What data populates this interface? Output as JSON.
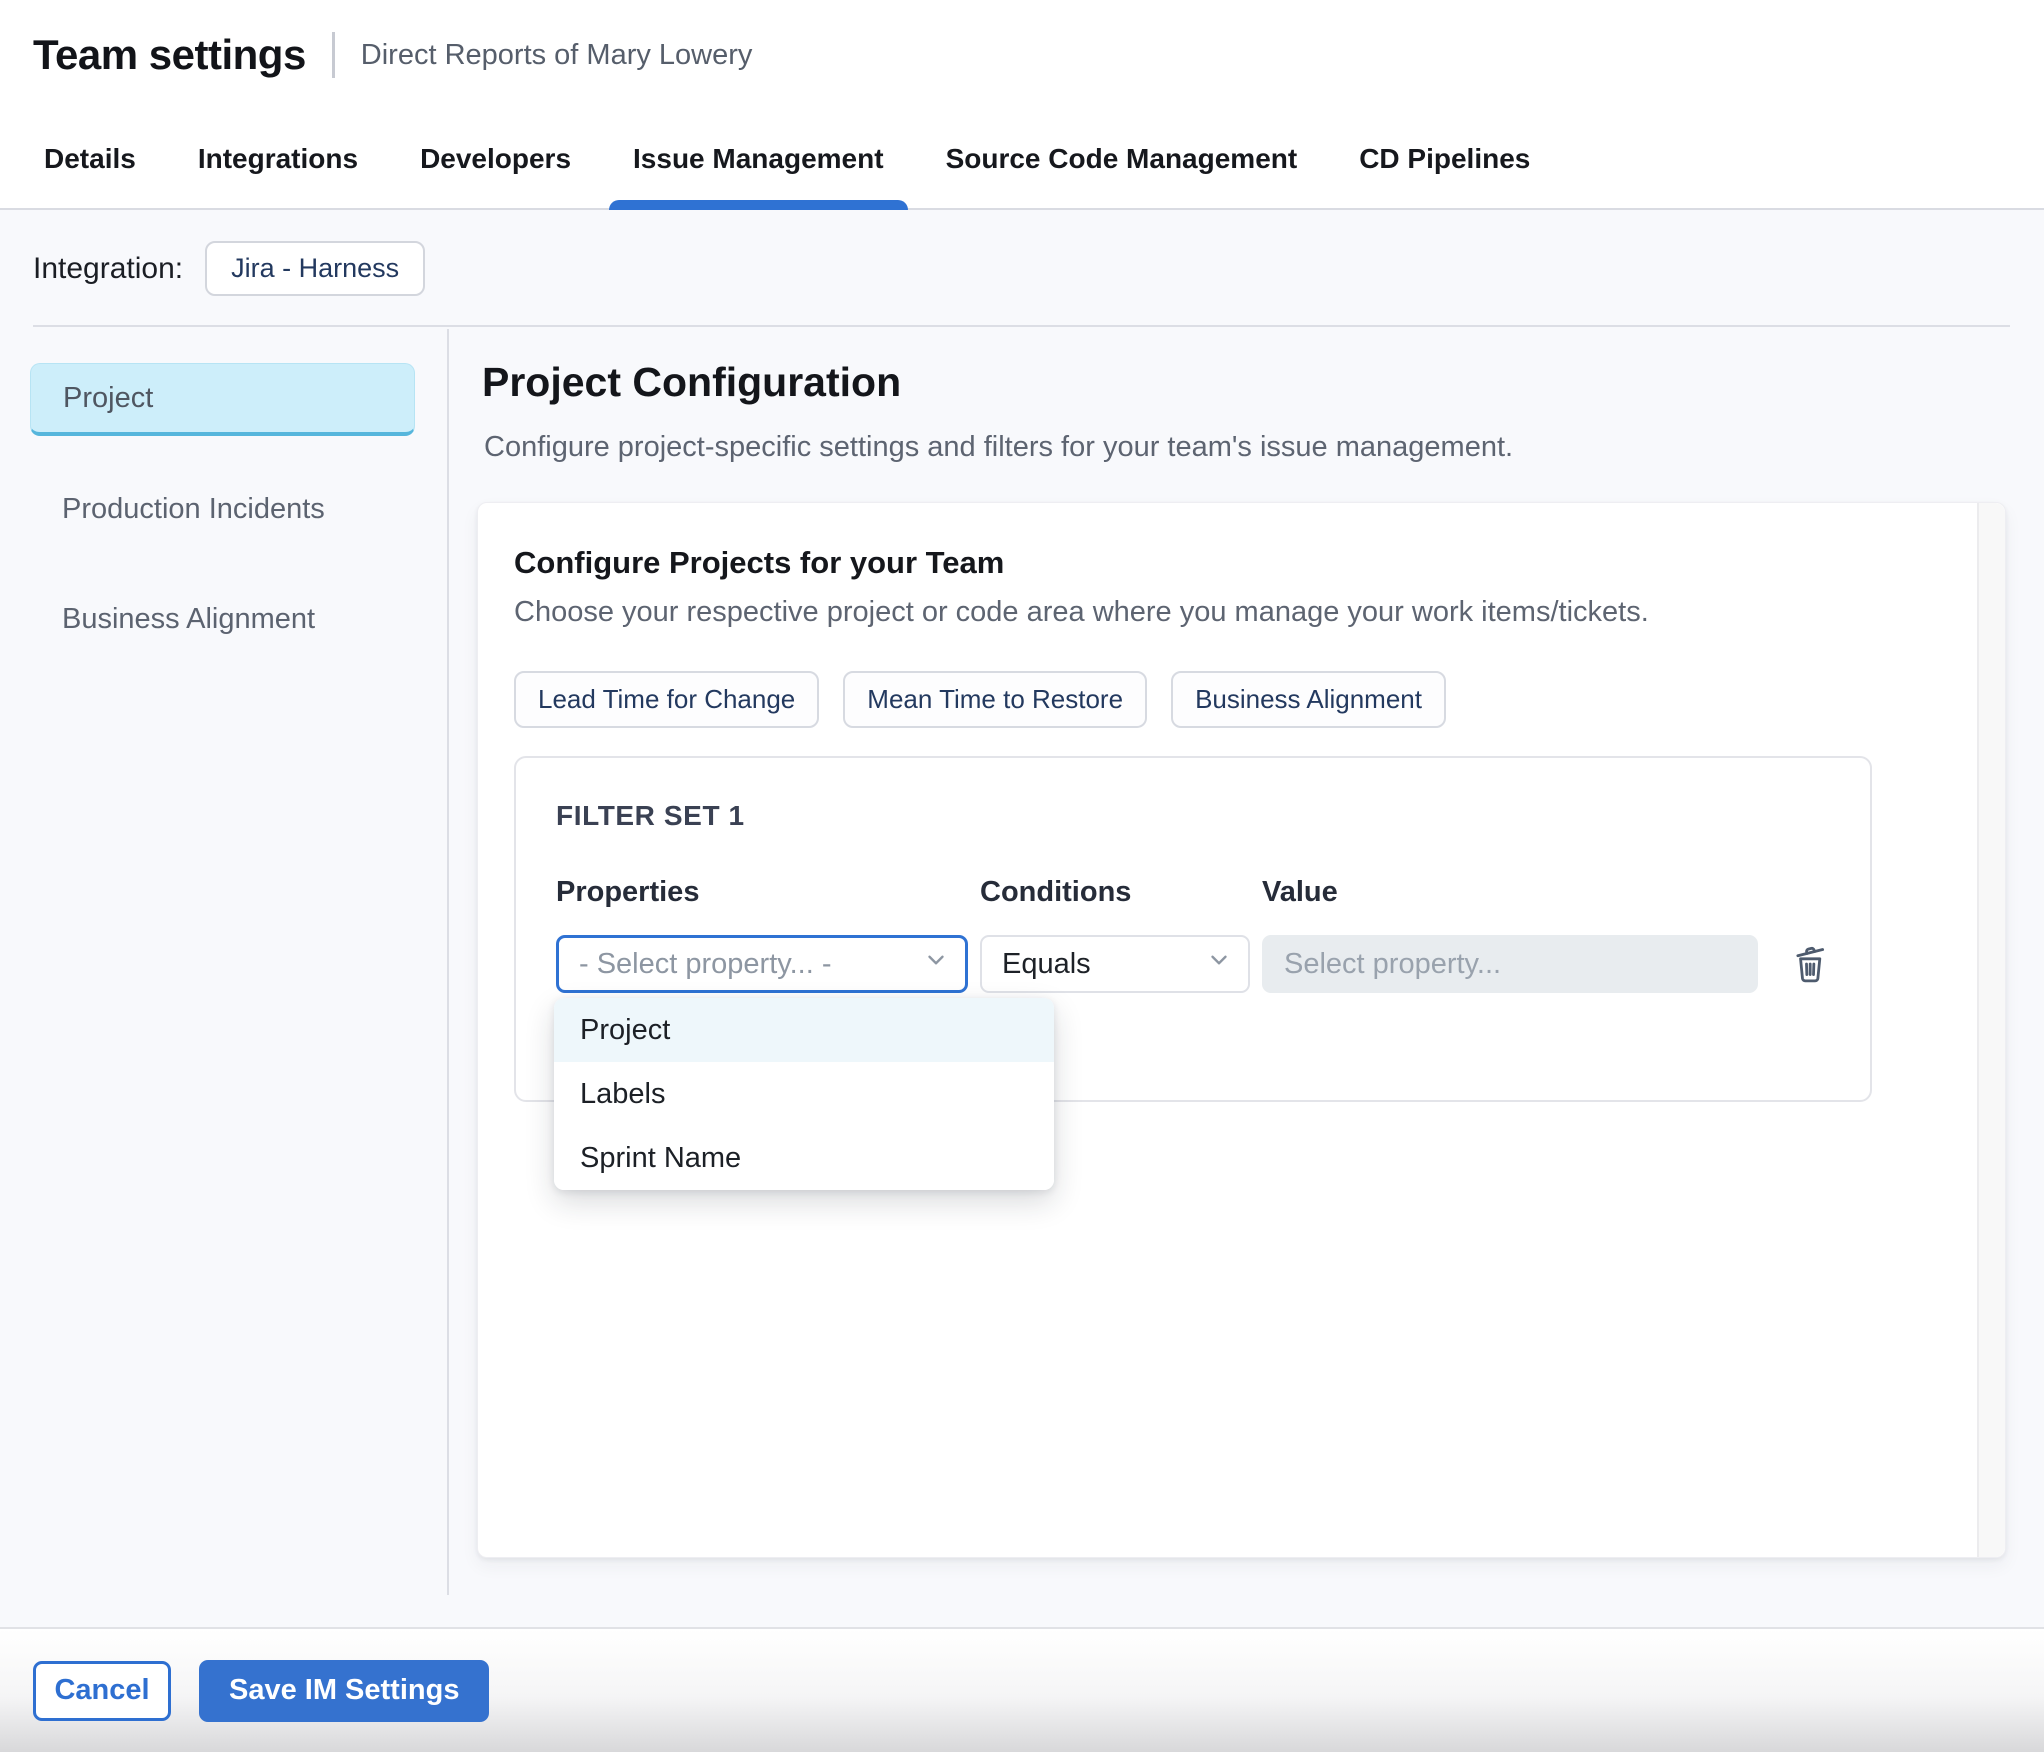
{
  "header": {
    "title": "Team settings",
    "subtitle": "Direct Reports of Mary Lowery"
  },
  "tabs": [
    {
      "label": "Details",
      "active": false
    },
    {
      "label": "Integrations",
      "active": false
    },
    {
      "label": "Developers",
      "active": false
    },
    {
      "label": "Issue Management",
      "active": true
    },
    {
      "label": "Source Code Management",
      "active": false
    },
    {
      "label": "CD Pipelines",
      "active": false
    }
  ],
  "integration": {
    "label": "Integration:",
    "value": "Jira - Harness"
  },
  "sidebar": {
    "items": [
      {
        "label": "Project",
        "selected": true
      },
      {
        "label": "Production Incidents",
        "selected": false
      },
      {
        "label": "Business Alignment",
        "selected": false
      }
    ]
  },
  "main": {
    "title": "Project Configuration",
    "description": "Configure project-specific settings and filters for your team's issue management.",
    "card": {
      "title": "Configure Projects for your Team",
      "description": "Choose your respective project or code area where you manage your work items/tickets.",
      "chips": [
        {
          "label": "Lead Time for Change"
        },
        {
          "label": "Mean Time to Restore"
        },
        {
          "label": "Business Alignment"
        }
      ],
      "filter_set": {
        "title": "FILTER SET 1",
        "columns": {
          "properties": "Properties",
          "conditions": "Conditions",
          "value": "Value"
        },
        "property_select": {
          "value": "- Select property... -"
        },
        "condition_select": {
          "value": "Equals"
        },
        "value_input": {
          "placeholder": "Select property..."
        },
        "dropdown": {
          "options": [
            {
              "label": "Project",
              "highlighted": true
            },
            {
              "label": "Labels",
              "highlighted": false
            },
            {
              "label": "Sprint Name",
              "highlighted": false
            }
          ]
        }
      }
    }
  },
  "footer": {
    "cancel_label": "Cancel",
    "save_label": "Save IM Settings"
  },
  "icons": {
    "property_select": "chevron-down-icon",
    "condition_select": "chevron-down-icon",
    "delete_filter": "trash-icon"
  },
  "colors": {
    "accent_blue": "#3572cf",
    "tab_underline": "#2f72d3",
    "selected_sidebar_bg": "#cdeefa",
    "selected_sidebar_border": "#56b6dc",
    "dropdown_highlight": "#eef7fb",
    "page_background": "#f8f9fc",
    "chip_text": "#23395f",
    "disabled_input_bg": "#e8ecef"
  }
}
